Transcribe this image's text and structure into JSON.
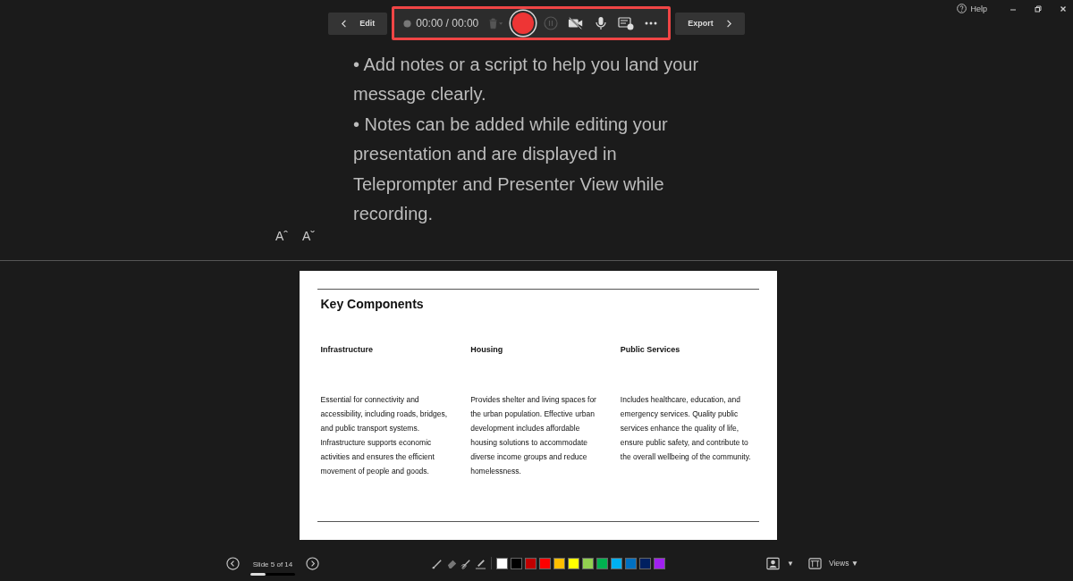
{
  "window": {
    "help": "Help"
  },
  "toolbar": {
    "edit": "Edit",
    "timer": "00:00 / 00:00",
    "export": "Export",
    "highlighted": true
  },
  "notes": {
    "lines": [
      "• Add notes or a script to help you land your message clearly.",
      "• Notes can be added while editing your presentation and are displayed in Teleprompter and Presenter View while recording."
    ],
    "increase_font": "Aˆ",
    "decrease_font": "Aˇ"
  },
  "slide": {
    "title": "Key Components",
    "columns": [
      {
        "heading": "Infrastructure",
        "body": "Essential for connectivity and accessibility, including roads, bridges, and public transport systems. Infrastructure supports economic activities and ensures the efficient movement of people and goods."
      },
      {
        "heading": "Housing",
        "body": "Provides shelter and living spaces for the urban population. Effective urban development includes affordable housing solutions to accommodate diverse income groups and reduce homelessness."
      },
      {
        "heading": "Public Services",
        "body": "Includes healthcare, education, and emergency services. Quality public services enhance the quality of life, ensure public safety, and contribute to the overall wellbeing of the community."
      }
    ]
  },
  "status_bar": {
    "slide_counter": "Slide 5 of 14",
    "progress": {
      "level": 0.33
    },
    "swatches": [
      {
        "color": "#ffffff"
      },
      {
        "color": "#000000"
      },
      {
        "color": "#c00000"
      },
      {
        "color": "#ff0000"
      },
      {
        "color": "#ffc000"
      },
      {
        "color": "#ffff00"
      },
      {
        "color": "#92d050"
      },
      {
        "color": "#00b050"
      },
      {
        "color": "#00b0f0"
      },
      {
        "color": "#0070c0"
      },
      {
        "color": "#002060"
      },
      {
        "color": "#a020f0"
      }
    ],
    "views": "Views ▼",
    "camera_caret": "▼"
  }
}
